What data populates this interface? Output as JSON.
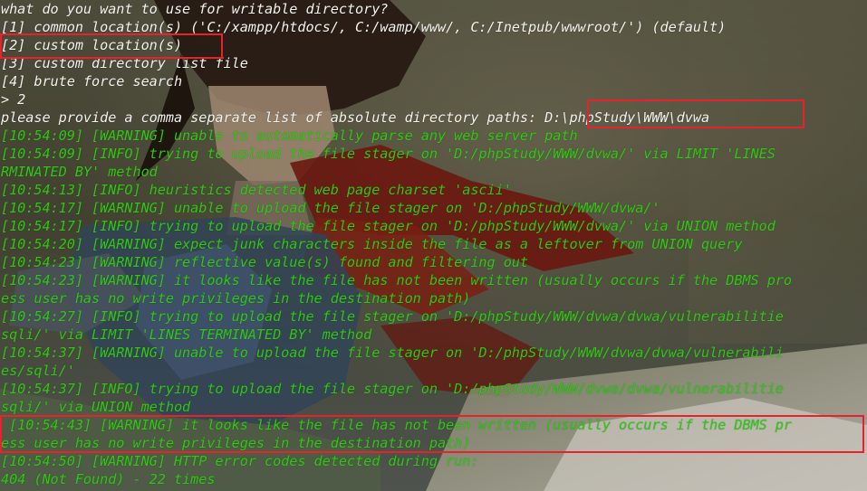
{
  "terminal": {
    "lines": [
      {
        "text": "what do you want to use for writable directory?",
        "color": "white"
      },
      {
        "text": "[1] common location(s) ('C:/xampp/htdocs/, C:/wamp/www/, C:/Inetpub/wwwroot/') (default)",
        "color": "white"
      },
      {
        "text": "[2] custom location(s)",
        "color": "white"
      },
      {
        "text": "[3] custom directory list file",
        "color": "white"
      },
      {
        "text": "[4] brute force search",
        "color": "white"
      },
      {
        "text": "> 2",
        "color": "white"
      },
      {
        "text": "please provide a comma separate list of absolute directory paths: D:\\phpStudy\\WWW\\dvwa",
        "color": "white"
      },
      {
        "text": "[10:54:09] [WARNING] unable to automatically parse any web server path",
        "color": "green"
      },
      {
        "text": "[10:54:09] [INFO] trying to upload the file stager on 'D:/phpStudy/WWW/dvwa/' via LIMIT 'LINES",
        "color": "green"
      },
      {
        "text": "RMINATED BY' method",
        "color": "green"
      },
      {
        "text": "[10:54:13] [INFO] heuristics detected web page charset 'ascii'",
        "color": "green"
      },
      {
        "text": "[10:54:17] [WARNING] unable to upload the file stager on 'D:/phpStudy/WWW/dvwa/'",
        "color": "green"
      },
      {
        "text": "[10:54:17] [INFO] trying to upload the file stager on 'D:/phpStudy/WWW/dvwa/' via UNION method",
        "color": "green"
      },
      {
        "text": "[10:54:20] [WARNING] expect junk characters inside the file as a leftover from UNION query",
        "color": "green"
      },
      {
        "text": "[10:54:23] [WARNING] reflective value(s) found and filtering out",
        "color": "green"
      },
      {
        "text": "[10:54:23] [WARNING] it looks like the file has not been written (usually occurs if the DBMS pro",
        "color": "green"
      },
      {
        "text": "ess user has no write privileges in the destination path)",
        "color": "green"
      },
      {
        "text": "[10:54:27] [INFO] trying to upload the file stager on 'D:/phpStudy/WWW/dvwa/dvwa/vulnerabilitie",
        "color": "green"
      },
      {
        "text": "sqli/' via LIMIT 'LINES TERMINATED BY' method",
        "color": "green"
      },
      {
        "text": "[10:54:37] [WARNING] unable to upload the file stager on 'D:/phpStudy/WWW/dvwa/dvwa/vulnerabili",
        "color": "green"
      },
      {
        "text": "es/sqli/'",
        "color": "green"
      },
      {
        "text": "[10:54:37] [INFO] trying to upload the file stager on 'D:/phpStudy/WWW/dvwa/dvwa/vulnerabilitie",
        "color": "green"
      },
      {
        "text": "sqli/' via UNION method",
        "color": "green"
      },
      {
        "text": " [10:54:43] [WARNING] it looks like the file has not been written (usually occurs if the DBMS pr",
        "color": "green"
      },
      {
        "text": "ess user has no write privileges in the destination path)",
        "color": "green"
      },
      {
        "text": "[10:54:50] [WARNING] HTTP error codes detected during run:",
        "color": "green"
      },
      {
        "text": "404 (Not Found) - 22 times",
        "color": "green"
      }
    ]
  },
  "colors": {
    "text_white": "#f2f2ee",
    "text_green": "#2fc814",
    "highlight_red": "#e8222a"
  }
}
